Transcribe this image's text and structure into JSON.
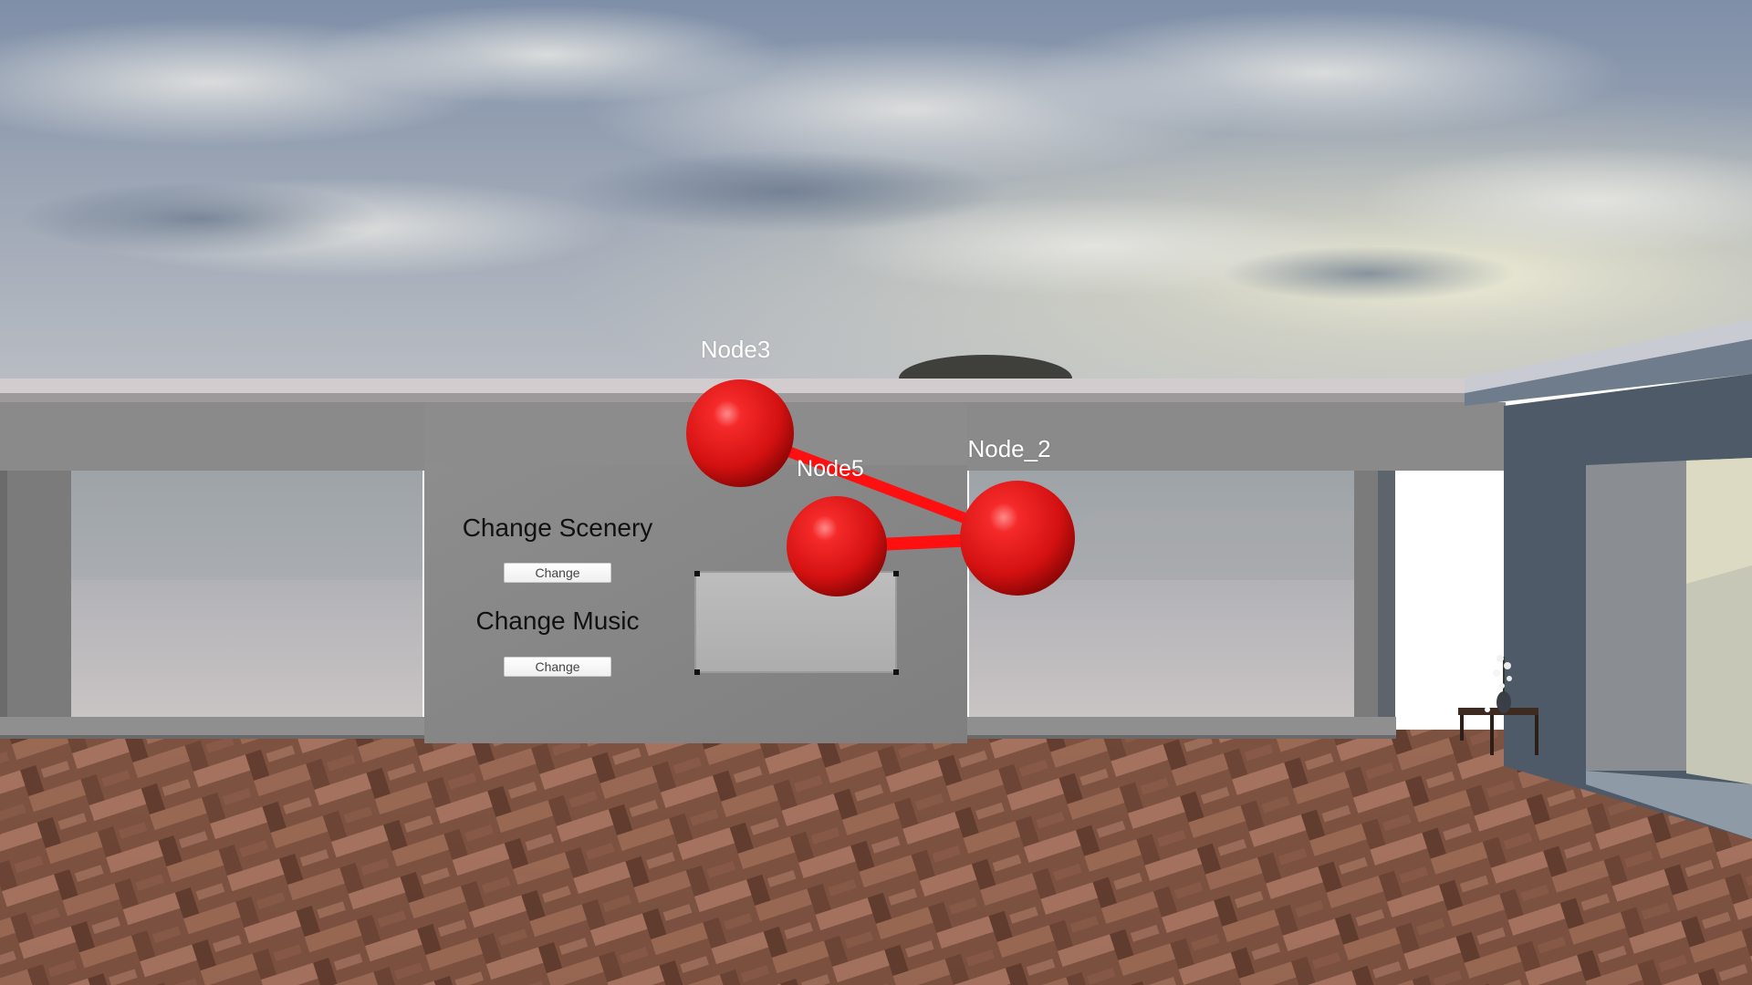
{
  "scene": {
    "name": "3d-room-scene",
    "background": {
      "sky": "sky-clouds",
      "floor": "parquet-herringbone-floor"
    }
  },
  "nodes": [
    {
      "id": "node3",
      "label": "Node3",
      "color": "#e31717"
    },
    {
      "id": "node5",
      "label": "Node5",
      "color": "#e31717"
    },
    {
      "id": "node2",
      "label": "Node_2",
      "color": "#e31717"
    }
  ],
  "edges": [
    {
      "from": "Node3",
      "to": "Node_2"
    },
    {
      "from": "Node5",
      "to": "Node_2"
    }
  ],
  "panel": {
    "scenery": {
      "heading": "Change Scenery",
      "button_label": "Change"
    },
    "music": {
      "heading": "Change Music",
      "button_label": "Change"
    },
    "screen": "blank-display-screen"
  },
  "colors": {
    "node_red": "#e31717",
    "edge_red": "#ff1010",
    "wall_gray": "#8b8b8b",
    "panel_gray": "#8a8a8a"
  }
}
